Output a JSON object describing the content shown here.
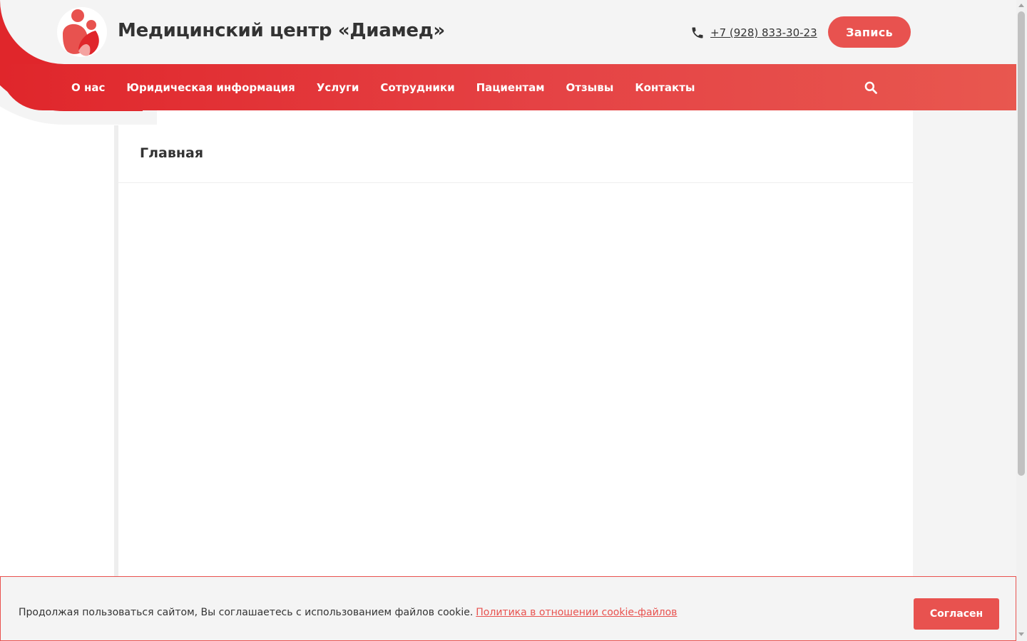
{
  "header": {
    "title": "Медицинский центр «Диамед»",
    "phone": "+7 (928) 833-30-23",
    "cta_label": "Запись"
  },
  "nav": {
    "items": [
      {
        "label": "О нас"
      },
      {
        "label": "Юридическая информация"
      },
      {
        "label": "Услуги"
      },
      {
        "label": "Сотрудники"
      },
      {
        "label": "Пациентам"
      },
      {
        "label": "Отзывы"
      },
      {
        "label": "Контакты"
      }
    ]
  },
  "main": {
    "title": "Главная"
  },
  "cookie": {
    "text": "Продолжая пользоваться сайтом, Вы соглашаетесь с использованием файлов cookie.",
    "link": "Политика в отношении cookie-файлов",
    "accept": "Согласен"
  },
  "icons": {
    "logo": "logo-icon",
    "phone": "phone-icon",
    "search": "search-icon"
  },
  "colors": {
    "brand_red": "#e0262b",
    "accent": "#e8524f",
    "header_bg": "#f4f4f4",
    "text": "#333333"
  }
}
